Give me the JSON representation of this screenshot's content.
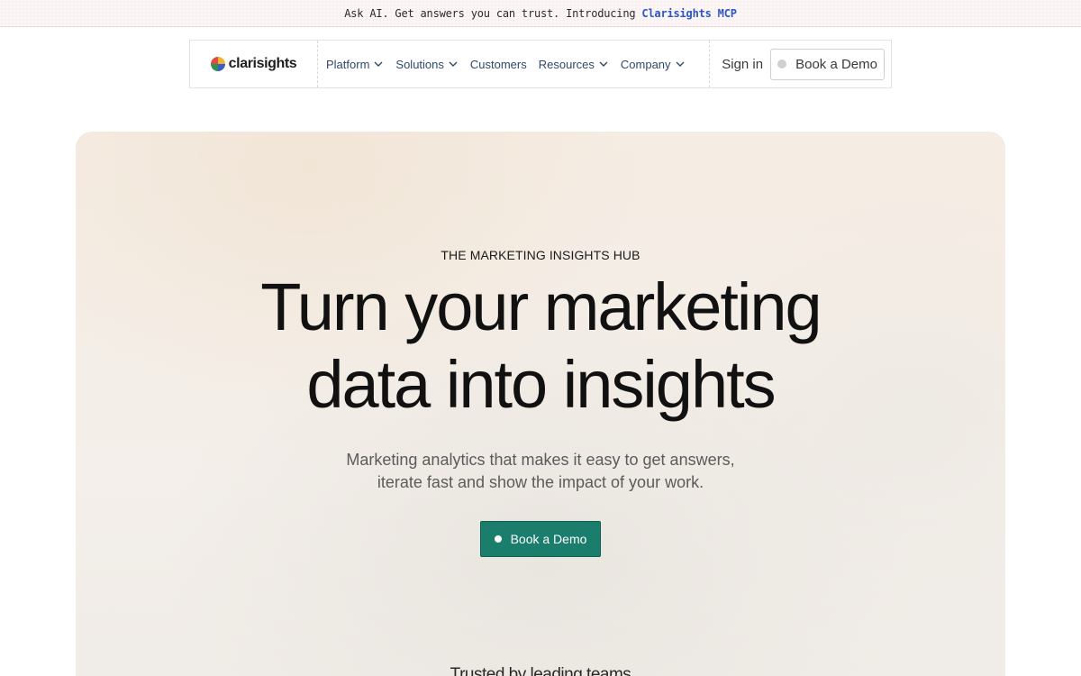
{
  "announcement": {
    "text": "Ask AI. Get answers you can trust. Introducing",
    "link_label": "Clarisights MCP"
  },
  "nav": {
    "brand": "clarisights",
    "menu": [
      {
        "label": "Platform",
        "has_dropdown": true
      },
      {
        "label": "Solutions",
        "has_dropdown": true
      },
      {
        "label": "Customers",
        "has_dropdown": false
      },
      {
        "label": "Resources",
        "has_dropdown": true
      },
      {
        "label": "Company",
        "has_dropdown": true
      }
    ],
    "sign_in": "Sign in",
    "demo_button": "Book a Demo"
  },
  "hero": {
    "eyebrow": "THE MARKETING INSIGHTS HUB",
    "headline_line1": "Turn your marketing",
    "headline_line2": "data into insights",
    "sub_line1": "Marketing analytics that makes it easy to get answers,",
    "sub_line2": "iterate fast and show the impact of your work.",
    "cta_label": "Book a Demo",
    "trusted_label": "Trusted by leading teams"
  },
  "colors": {
    "accent": "#1b7d6c",
    "announcement_link": "#2e55c4",
    "nav_link": "#2f4a6a",
    "logo_red": "#e24b3b",
    "logo_yellow": "#f2b233",
    "logo_green": "#2f8f5b",
    "logo_blue": "#3a5fc8"
  },
  "icons": {
    "logo": "clarisights-pinwheel-icon",
    "dropdown": "chevron-down-icon",
    "demo_dot": "dot-icon"
  }
}
